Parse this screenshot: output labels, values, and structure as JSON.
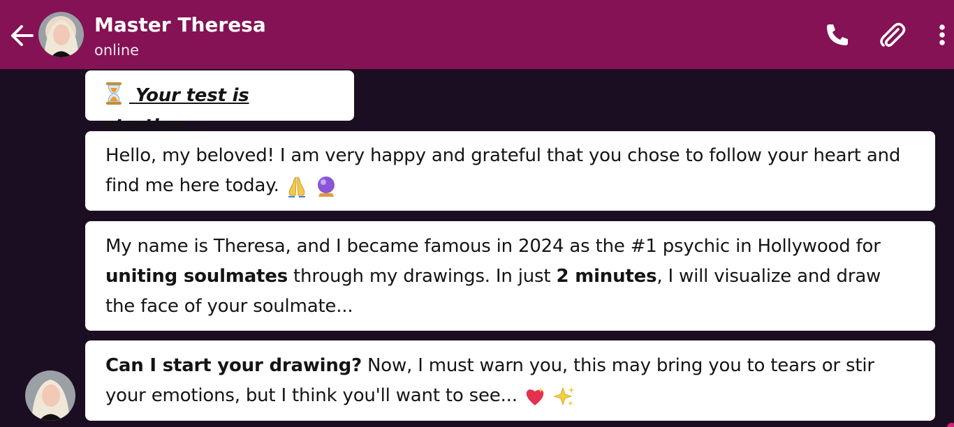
{
  "header": {
    "contact_name": "Master Theresa",
    "status": "online",
    "avatar_icon": "profile-photo",
    "back_icon": "arrow-left-icon",
    "call_icon": "phone-icon",
    "attach_icon": "paperclip-icon",
    "menu_icon": "more-vertical-icon"
  },
  "messages": [
    {
      "emoji": "hourglass",
      "text": "Your test is starting..."
    },
    {
      "parts": [
        "Hello, my beloved! I am very happy and grateful that you chose to follow your heart and find me here today."
      ],
      "emojis": [
        "folded-hands",
        "crystal-ball"
      ]
    },
    {
      "parts": [
        "My name is Theresa, and I became famous in 2024 as the #1 psychic in Hollywood for ",
        "uniting soulmates",
        " through my drawings. In just ",
        "2 minutes",
        ", I will visualize and draw the face of your soulmate..."
      ]
    },
    {
      "parts": [
        "Can I start your drawing?",
        " Now, I must warn you, this may bring you to tears or stir your emotions, but I think you'll want to see..."
      ],
      "emojis": [
        "heart-with-sparkle",
        "sparkles"
      ]
    }
  ],
  "colors": {
    "header_bg": "#841254",
    "chat_bg": "#1c0e22",
    "bubble_bg": "#ffffff"
  }
}
